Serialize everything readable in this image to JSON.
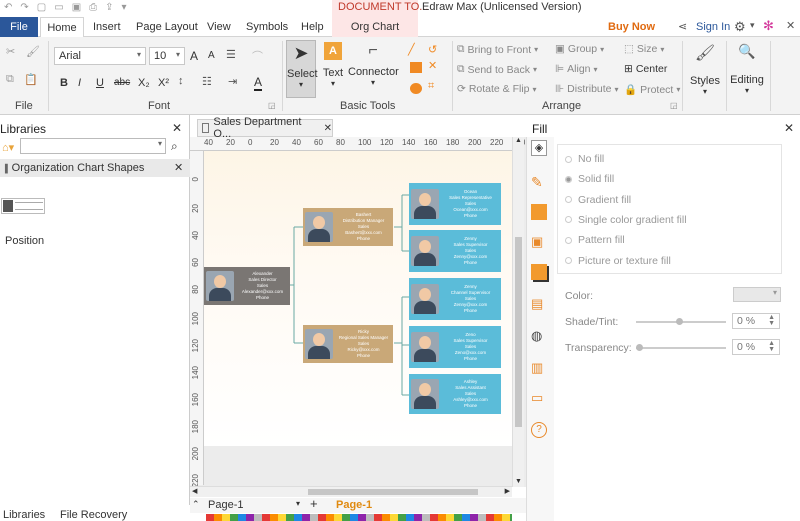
{
  "title_bar": {
    "doc_title": "DOCUMENT TO...",
    "app_title": "Edraw Max (Unlicensed Version)"
  },
  "tabs": {
    "file": "File",
    "home": "Home",
    "insert": "Insert",
    "page_layout": "Page Layout",
    "view": "View",
    "symbols": "Symbols",
    "help": "Help",
    "org_chart": "Org Chart"
  },
  "account": {
    "buy_now": "Buy Now",
    "sign_in": "Sign In"
  },
  "ribbon": {
    "font_name": "Arial",
    "font_size": "10",
    "file_group": "File",
    "font_group": "Font",
    "basic_tools_group": "Basic Tools",
    "arrange_group": "Arrange",
    "select": "Select",
    "text": "Text",
    "connector": "Connector",
    "bring_to_front": "Bring to Front",
    "send_to_back": "Send to Back",
    "rotate_flip": "Rotate & Flip",
    "group": "Group",
    "align": "Align",
    "distribute": "Distribute",
    "size": "Size",
    "center": "Center",
    "protect": "Protect",
    "styles": "Styles",
    "editing": "Editing",
    "format_b": "B",
    "format_i": "I",
    "format_u": "U",
    "format_abc": "abc",
    "format_x2": "X₂",
    "format_x2sup": "X²",
    "grow": "A",
    "shrink": "A",
    "font_color": "A"
  },
  "libraries": {
    "title": "Libraries",
    "section": "Organization Chart Shapes",
    "position_label": "Position"
  },
  "document_tab": {
    "name": "Sales Department O..."
  },
  "ruler": {
    "top": [
      "40",
      "20",
      "0",
      "20",
      "40",
      "60",
      "80",
      "100",
      "120",
      "140",
      "160",
      "180",
      "200",
      "220",
      "240"
    ],
    "left": [
      "0",
      "20",
      "40",
      "60",
      "80",
      "100",
      "120",
      "140",
      "160",
      "180",
      "200",
      "220"
    ]
  },
  "org_nodes": [
    {
      "role": "root",
      "lines": [
        "Alexander",
        "Sales Director",
        "Sales",
        "Alexander@xxx.com",
        "Phone"
      ]
    },
    {
      "role": "mgr1",
      "lines": [
        "Bashert",
        "Distribution Manager",
        "Sales",
        "Bashert@xxx.com",
        "Phone"
      ]
    },
    {
      "role": "mgr2",
      "lines": [
        "Ricky",
        "Regional Sales Manager",
        "Sales",
        "Ricky@xxx.com",
        "Phone"
      ]
    },
    {
      "role": "s1",
      "lines": [
        "Ocean",
        "Sales Representative",
        "Sales",
        "Ocean@xxx.com",
        "Phone"
      ]
    },
    {
      "role": "s2",
      "lines": [
        "Zenny",
        "Sales Supervisor",
        "Sales",
        "Zenny@xxx.com",
        "Phone"
      ]
    },
    {
      "role": "s3",
      "lines": [
        "Zenny",
        "Channel Supervisor",
        "Sales",
        "Zenny@xxx.com",
        "Phone"
      ]
    },
    {
      "role": "s4",
      "lines": [
        "Zeno",
        "Sales Supervisor",
        "Sales",
        "Zeno@xxx.com",
        "Phone"
      ]
    },
    {
      "role": "s5",
      "lines": [
        "Ashley",
        "Sales Assistant",
        "Sales",
        "Ashley@xxx.com",
        "Phone"
      ]
    }
  ],
  "page_bar": {
    "page_select": "Page-1",
    "page_tab": "Page-1"
  },
  "bottom_tabs": {
    "libraries": "Libraries",
    "file_recovery": "File Recovery"
  },
  "fill_panel": {
    "title": "Fill",
    "options": [
      "No fill",
      "Solid fill",
      "Gradient fill",
      "Single color gradient fill",
      "Pattern fill",
      "Picture or texture fill"
    ],
    "color_label": "Color:",
    "shade_label": "Shade/Tint:",
    "shade_value": "0 %",
    "transparency_label": "Transparency:",
    "transparency_value": "0 %"
  },
  "colors": {
    "accent_blue": "#2b579a",
    "node_tan": "#c9a878",
    "node_gray": "#7a7673",
    "node_blue": "#5bbcd9",
    "buy_now": "#e06a10",
    "org_tab_bg": "#fde6e6"
  }
}
